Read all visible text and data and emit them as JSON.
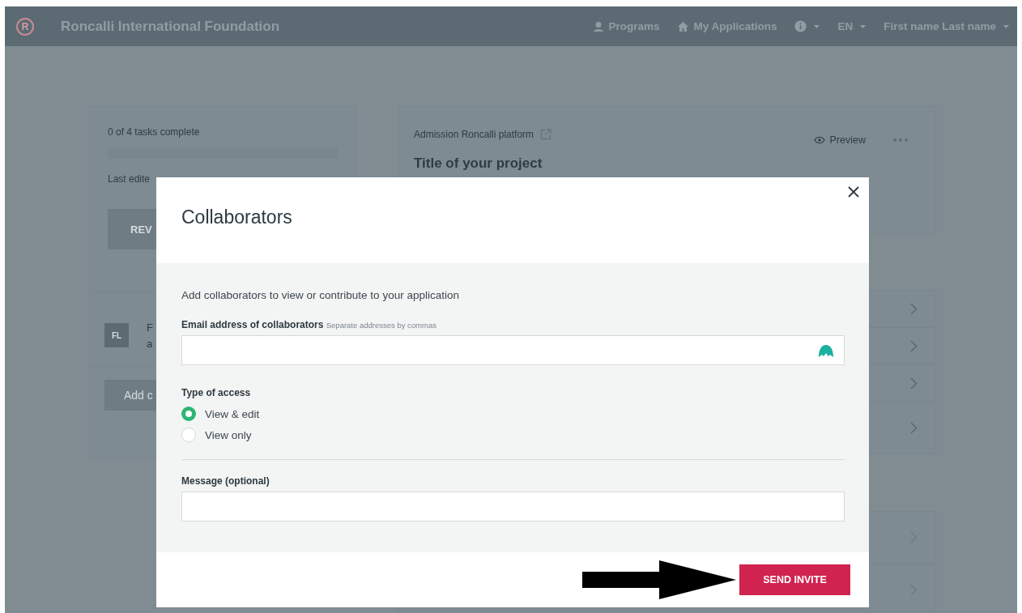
{
  "header": {
    "logo_letter": "R",
    "title": "Roncalli International Foundation",
    "nav": [
      {
        "kind": "programs",
        "label": "Programs"
      },
      {
        "kind": "applications",
        "label": "My Applications"
      },
      {
        "kind": "info"
      },
      {
        "kind": "language",
        "label": "EN"
      },
      {
        "kind": "user",
        "label": "First name Last name"
      }
    ]
  },
  "progress_card": {
    "tasks": "0 of 4 tasks complete",
    "level": 0,
    "last_edited": "Last edite",
    "review_button": "REV",
    "avatar": "FL",
    "member_line_1": "F",
    "member_line_2": "a",
    "add_button": "Add c"
  },
  "application_card": {
    "program": "Admission Roncalli platform",
    "preview": "Preview",
    "title": "Title of your project"
  },
  "modal": {
    "title": "Collaborators",
    "intro": "Add collaborators to view or contribute to your application",
    "email_label": "Email address of collaborators",
    "email_hint": "Separate addresses by commas",
    "access_label": "Type of access",
    "access_options": [
      {
        "label": "View & edit",
        "selected": true
      },
      {
        "label": "View only",
        "selected": false
      }
    ],
    "message_label": "Message (optional)",
    "send_button": "SEND INVITE"
  }
}
